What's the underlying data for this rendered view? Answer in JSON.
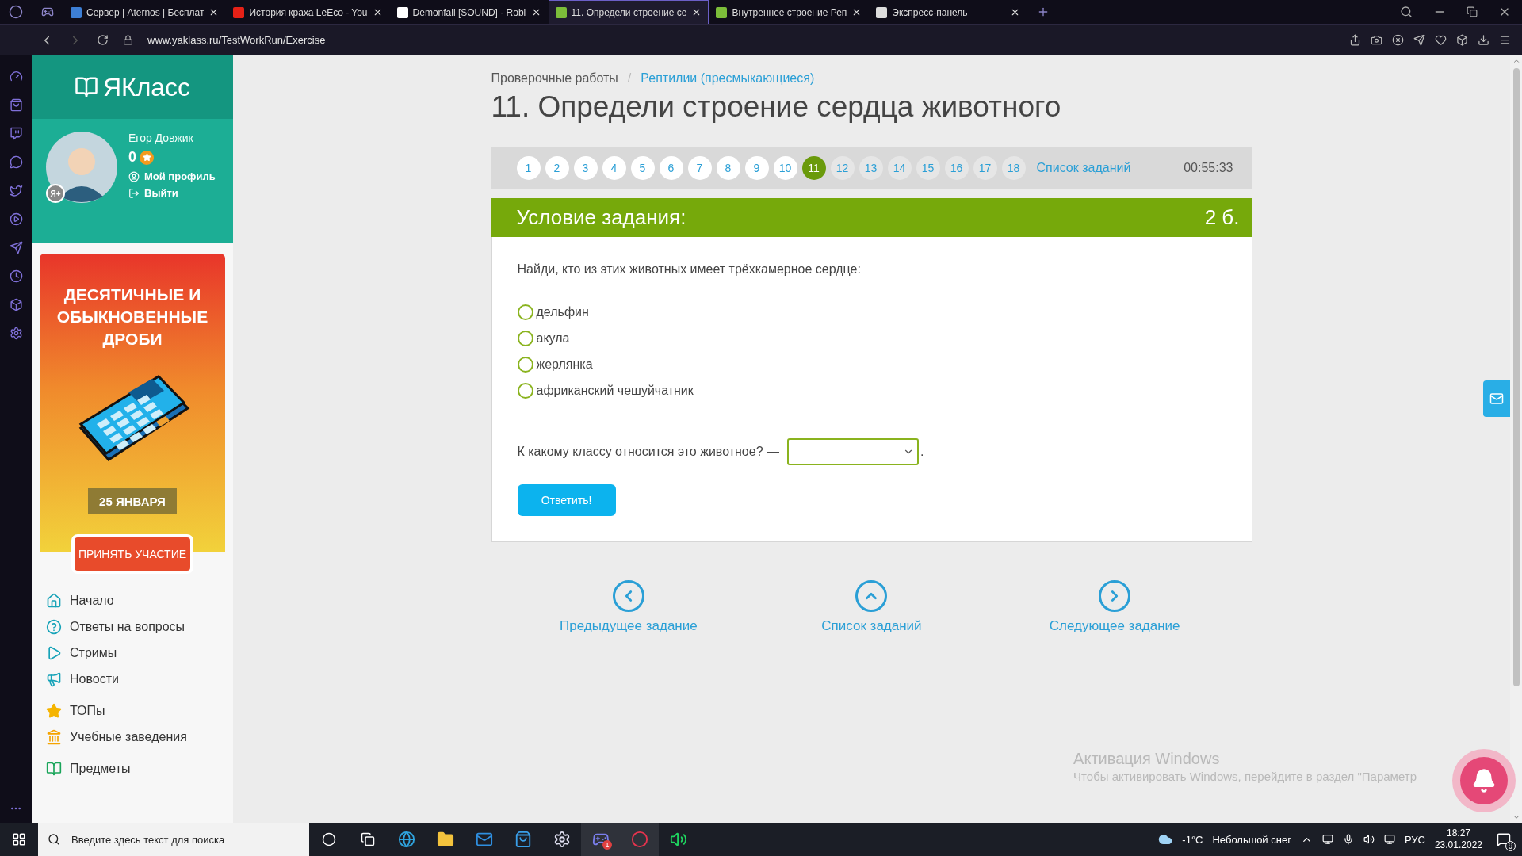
{
  "browser": {
    "tabs": [
      {
        "title": "Сервер | Aternos | Бесплат",
        "kind": "aternos",
        "selected": false
      },
      {
        "title": "История краха LeEco - You",
        "kind": "youtube",
        "selected": false
      },
      {
        "title": "Demonfall [SOUND] - Robl",
        "kind": "roblox",
        "selected": false
      },
      {
        "title": "11. Определи строение се",
        "kind": "yaklass",
        "selected": true
      },
      {
        "title": "Внутреннее строение Реп",
        "kind": "yaklass",
        "selected": false
      },
      {
        "title": "Экспресс-панель",
        "kind": "speeddial",
        "selected": false
      }
    ],
    "address": "www.yaklass.ru/TestWorkRun/Exercise"
  },
  "site": {
    "logo": "ЯКласс",
    "user": {
      "name": "Егор Довжик",
      "points": "0",
      "badge": "Я+",
      "links": [
        {
          "label": "Мой профиль",
          "kind": "profile"
        },
        {
          "label": "Выйти",
          "kind": "logout"
        }
      ]
    },
    "banner": {
      "title": "ДЕСЯТИЧНЫЕ И ОБЫКНОВЕННЫЕ ДРОБИ",
      "date": "25 ЯНВАРЯ",
      "button": "ПРИНЯТЬ УЧАСТИЕ"
    },
    "nav": [
      [
        {
          "label": "Начало",
          "kind": "home"
        },
        {
          "label": "Ответы на вопросы",
          "kind": "help"
        },
        {
          "label": "Стримы",
          "kind": "stream"
        },
        {
          "label": "Новости",
          "kind": "news"
        }
      ],
      [
        {
          "label": "ТОПы",
          "kind": "top"
        },
        {
          "label": "Учебные заведения",
          "kind": "school"
        }
      ],
      [
        {
          "label": "Предметы",
          "kind": "subjects"
        }
      ]
    ]
  },
  "breadcrumb": [
    {
      "label": "Проверочные работы",
      "link": false
    },
    {
      "label": "Рептилии (пресмыкающиеся)",
      "link": true
    }
  ],
  "breadcrumb_separator": "/",
  "title": "11. Определи строение сердца животного",
  "tasks": {
    "items": [
      {
        "label": "1",
        "selected": false,
        "visited": true
      },
      {
        "label": "2",
        "selected": false,
        "visited": true
      },
      {
        "label": "3",
        "selected": false,
        "visited": true
      },
      {
        "label": "4",
        "selected": false,
        "visited": true
      },
      {
        "label": "5",
        "selected": false,
        "visited": true
      },
      {
        "label": "6",
        "selected": false,
        "visited": true
      },
      {
        "label": "7",
        "selected": false,
        "visited": true
      },
      {
        "label": "8",
        "selected": false,
        "visited": true
      },
      {
        "label": "9",
        "selected": false,
        "visited": true
      },
      {
        "label": "10",
        "selected": false,
        "visited": true
      },
      {
        "label": "11",
        "selected": true,
        "visited": true
      },
      {
        "label": "12",
        "selected": false,
        "visited": false
      },
      {
        "label": "13",
        "selected": false,
        "visited": false
      },
      {
        "label": "14",
        "selected": false,
        "visited": false
      },
      {
        "label": "15",
        "selected": false,
        "visited": false
      },
      {
        "label": "16",
        "selected": false,
        "visited": false
      },
      {
        "label": "17",
        "selected": false,
        "visited": false
      },
      {
        "label": "18",
        "selected": false,
        "visited": false
      }
    ],
    "list_link": "Список заданий",
    "timer": "00:55:33"
  },
  "task": {
    "header": "Условие задания:",
    "points": "2 б.",
    "question": "Найди, кто из этих животных имеет трёхкамерное сердце:",
    "options": [
      {
        "label": "дельфин",
        "selected": false
      },
      {
        "label": "акула",
        "selected": false
      },
      {
        "label": "жерлянка",
        "selected": false
      },
      {
        "label": "африканский чешуйчатник",
        "selected": false
      }
    ],
    "select_prompt": "К какому классу относится это животное? —",
    "select_suffix": ".",
    "answer_button": "Ответить!"
  },
  "bottom_nav": [
    {
      "kind": "prev",
      "label": "Предыдущее задание"
    },
    {
      "kind": "up",
      "label": "Список заданий"
    },
    {
      "kind": "next",
      "label": "Следующее задание"
    }
  ],
  "activation": {
    "title": "Активация Windows",
    "text": "Чтобы активировать Windows, перейдите в раздел \"Параметр"
  },
  "taskbar": {
    "search_placeholder": "Введите здесь текст для поиска",
    "discord_badge": "1",
    "temperature": "-1°C",
    "weather": "Небольшой снег",
    "language": "РУС",
    "time": "18:27",
    "date": "23.01.2022",
    "notifications": "9"
  }
}
